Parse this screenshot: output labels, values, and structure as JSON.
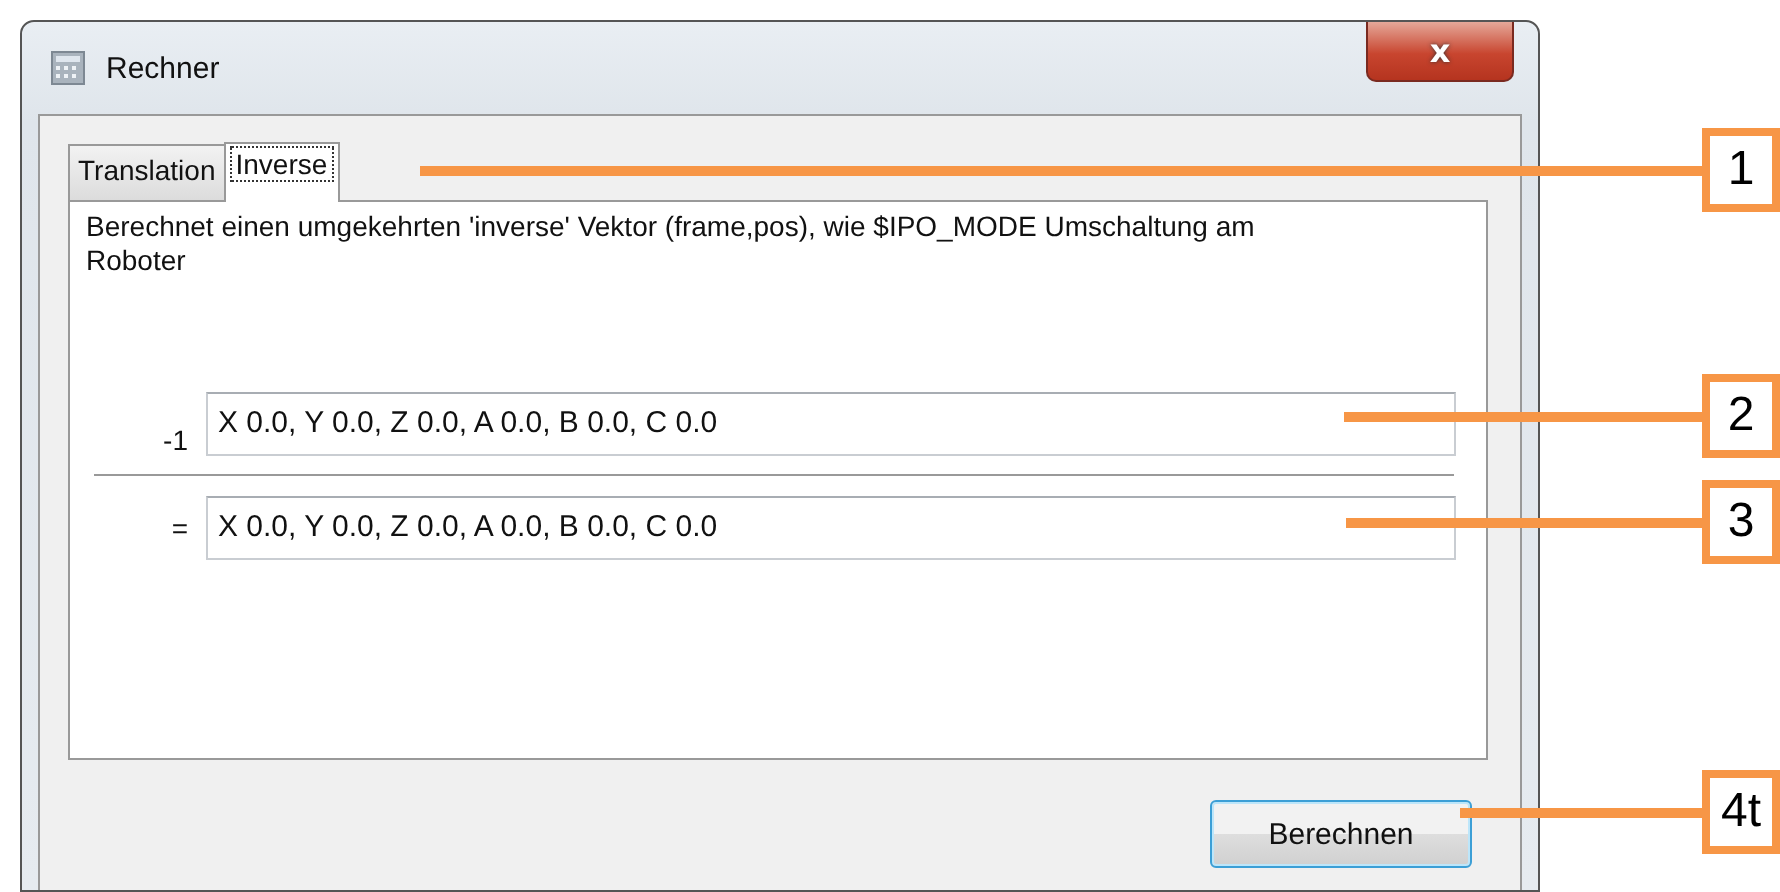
{
  "window": {
    "title": "Rechner",
    "close": "x"
  },
  "tabs": [
    {
      "label": "Translation",
      "selected": false
    },
    {
      "label": "Inverse",
      "selected": true
    }
  ],
  "description": "Berechnet einen umgekehrten 'inverse' Vektor (frame,pos), wie $IPO_MODE Umschaltung am Roboter",
  "rows": [
    {
      "operator": "-1",
      "value": "X 0.0, Y 0.0, Z 0.0, A 0.0, B 0.0, C 0.0"
    },
    {
      "operator": "=",
      "value": "X 0.0, Y 0.0, Z 0.0, A 0.0, B 0.0, C 0.0"
    }
  ],
  "button": "Berechnen",
  "callouts": [
    {
      "label": "1"
    },
    {
      "label": "2"
    },
    {
      "label": "3"
    },
    {
      "label": "4t"
    }
  ]
}
